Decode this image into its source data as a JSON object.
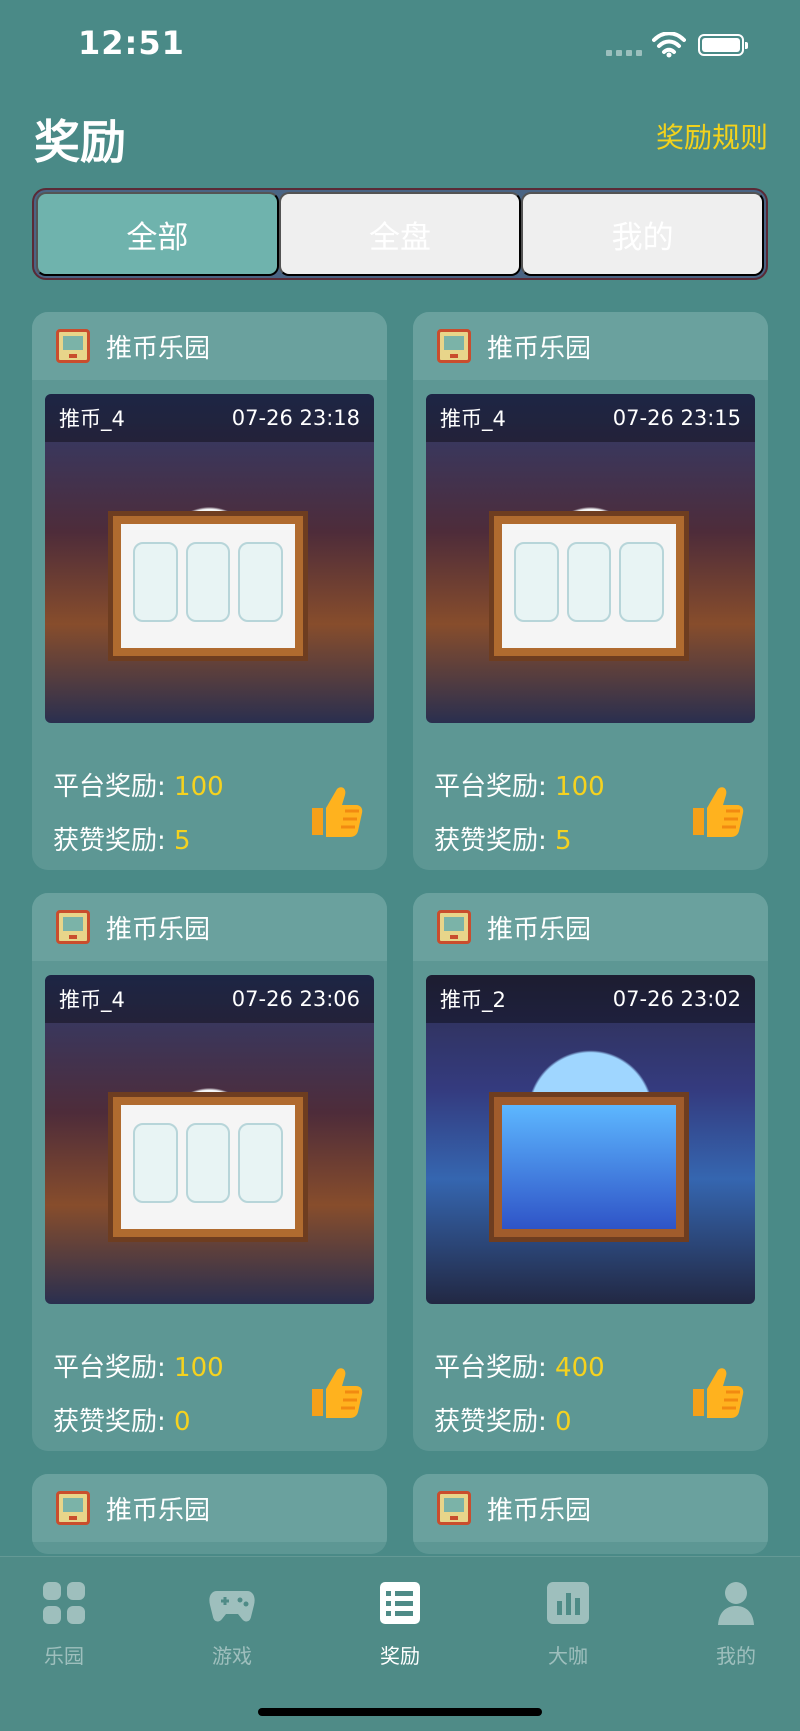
{
  "status_bar": {
    "time": "12:51"
  },
  "header": {
    "title": "奖励",
    "rules_link": "奖励规则"
  },
  "segments": [
    {
      "label": "全部",
      "active": true
    },
    {
      "label": "全盘",
      "active": false
    },
    {
      "label": "我的",
      "active": false
    }
  ],
  "cards": [
    {
      "title": "推币乐园",
      "machine": "推币_4",
      "time": "07-26 23:18",
      "platform_label": "平台奖励:",
      "platform_value": "100",
      "like_label": "获赞奖励:",
      "like_value": "5"
    },
    {
      "title": "推币乐园",
      "machine": "推币_4",
      "time": "07-26 23:15",
      "platform_label": "平台奖励:",
      "platform_value": "100",
      "like_label": "获赞奖励:",
      "like_value": "5"
    },
    {
      "title": "推币乐园",
      "machine": "推币_4",
      "time": "07-26 23:06",
      "platform_label": "平台奖励:",
      "platform_value": "100",
      "like_label": "获赞奖励:",
      "like_value": "0"
    },
    {
      "title": "推币乐园",
      "machine": "推币_2",
      "time": "07-26 23:02",
      "platform_label": "平台奖励:",
      "platform_value": "400",
      "like_label": "获赞奖励:",
      "like_value": "0"
    },
    {
      "title": "推币乐园"
    },
    {
      "title": "推币乐园"
    }
  ],
  "tabbar": [
    {
      "label": "乐园",
      "icon": "grid-icon",
      "active": false
    },
    {
      "label": "游戏",
      "icon": "gamepad-icon",
      "active": false
    },
    {
      "label": "奖励",
      "icon": "list-icon",
      "active": true
    },
    {
      "label": "大咖",
      "icon": "chart-icon",
      "active": false
    },
    {
      "label": "我的",
      "icon": "user-icon",
      "active": false
    }
  ],
  "colors": {
    "background": "#4a8a87",
    "accent_yellow": "#f3d21c",
    "segment_active": "#6fb3ad",
    "card": "#5d9794"
  }
}
